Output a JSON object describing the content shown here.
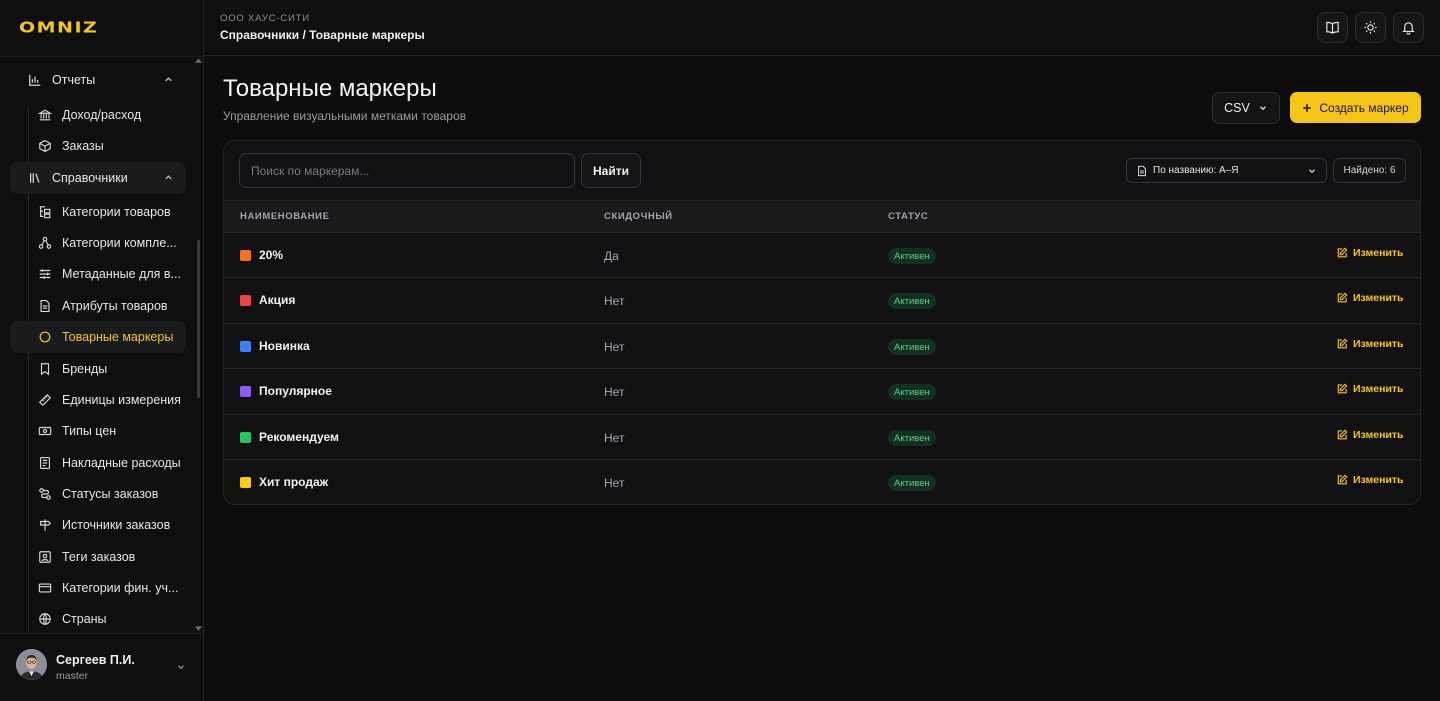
{
  "brand": {
    "logo": "OMNIZ",
    "accent": "#f5c518"
  },
  "header": {
    "org": "ООО ХАУС-СИТИ",
    "breadcrumb": "Справочники / Товарные маркеры",
    "buttons": [
      "book-icon",
      "sun-icon",
      "bell-icon"
    ]
  },
  "sidebar": {
    "groups": [
      {
        "label": "Отчеты",
        "icon": "bar-chart-icon",
        "expanded": true,
        "items": [
          {
            "label": "Доход/расход",
            "icon": "bank-icon"
          },
          {
            "label": "Заказы",
            "icon": "box-icon"
          }
        ]
      },
      {
        "label": "Справочники",
        "icon": "library-icon",
        "expanded": true,
        "items": [
          {
            "label": "Категории товаров",
            "icon": "category-tree-icon"
          },
          {
            "label": "Категории компле...",
            "icon": "hierarchy-icon"
          },
          {
            "label": "Метаданные для в...",
            "icon": "sliders-icon"
          },
          {
            "label": "Атрибуты товаров",
            "icon": "document-icon"
          },
          {
            "label": "Товарные маркеры",
            "icon": "circle-icon",
            "active": true
          },
          {
            "label": "Бренды",
            "icon": "bookmark-icon"
          },
          {
            "label": "Единицы измерения",
            "icon": "ruler-icon"
          },
          {
            "label": "Типы цен",
            "icon": "banknote-icon"
          },
          {
            "label": "Накладные расходы",
            "icon": "receipt-icon"
          },
          {
            "label": "Статусы заказов",
            "icon": "route-icon"
          },
          {
            "label": "Источники заказов",
            "icon": "signpost-icon"
          },
          {
            "label": "Теги заказов",
            "icon": "scan-tag-icon"
          },
          {
            "label": "Категории фин. уч...",
            "icon": "card-icon"
          },
          {
            "label": "Страны",
            "icon": "globe-icon"
          }
        ]
      }
    ]
  },
  "user": {
    "name": "Сергеев П.И.",
    "role": "master"
  },
  "page": {
    "title": "Товарные маркеры",
    "subtitle": "Управление визуальными метками товаров",
    "csv_label": "CSV",
    "create_label": "Создать маркер"
  },
  "toolbar": {
    "search_placeholder": "Поиск по маркерам...",
    "find_label": "Найти",
    "sort_value": "По названию: А–Я",
    "found_label": "Найдено: 6"
  },
  "table": {
    "columns": [
      "НАИМЕНОВАНИЕ",
      "СКИДОЧНЫЙ",
      "СТАТУС"
    ],
    "edit_label": "Изменить",
    "rows": [
      {
        "name": "20%",
        "color": "#f97316",
        "discount": "Да",
        "status": "Активен"
      },
      {
        "name": "Акция",
        "color": "#ef4444",
        "discount": "Нет",
        "status": "Активен"
      },
      {
        "name": "Новинка",
        "color": "#3b82f6",
        "discount": "Нет",
        "status": "Активен"
      },
      {
        "name": "Популярное",
        "color": "#8b5cf6",
        "discount": "Нет",
        "status": "Активен"
      },
      {
        "name": "Рекомендуем",
        "color": "#22c55e",
        "discount": "Нет",
        "status": "Активен"
      },
      {
        "name": "Хит продаж",
        "color": "#facc15",
        "discount": "Нет",
        "status": "Активен"
      }
    ]
  }
}
